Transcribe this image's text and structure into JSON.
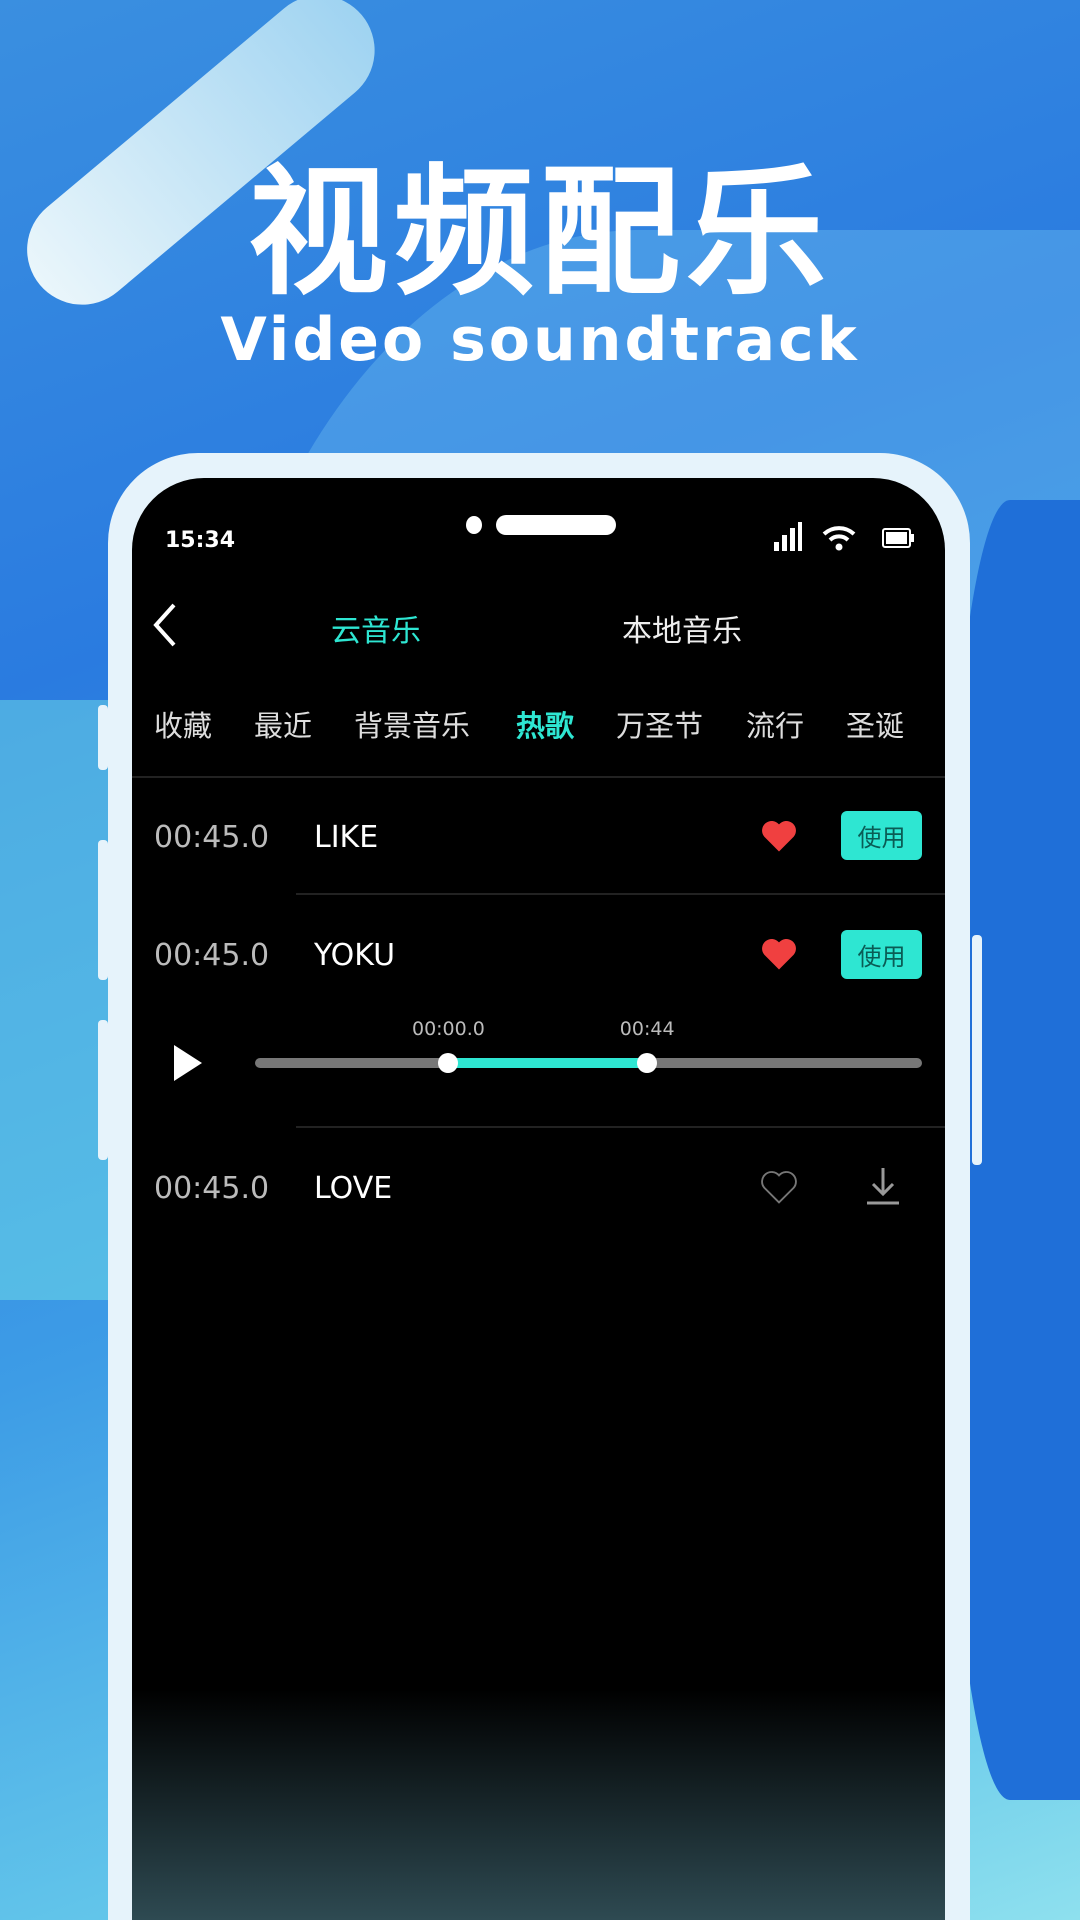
{
  "banner": {
    "title": "视频配乐",
    "subtitle": "Video soundtrack"
  },
  "status_bar": {
    "time": "15:34",
    "icons": [
      "signal-icon",
      "wifi-icon",
      "battery-icon"
    ]
  },
  "header": {
    "back_icon": "chevron-left-icon",
    "tabs": [
      {
        "label": "云音乐",
        "active": true
      },
      {
        "label": "本地音乐",
        "active": false
      }
    ]
  },
  "categories": [
    {
      "label": "收藏"
    },
    {
      "label": "最近"
    },
    {
      "label": "背景音乐"
    },
    {
      "label": "热歌",
      "active": true
    },
    {
      "label": "万圣节"
    },
    {
      "label": "流行"
    },
    {
      "label": "圣诞"
    }
  ],
  "tracks": [
    {
      "duration": "00:45.0",
      "name": "LIKE",
      "favorited": true,
      "action": "使用"
    },
    {
      "duration": "00:45.0",
      "name": "YOKU",
      "favorited": true,
      "action": "使用"
    },
    {
      "duration": "00:45.0",
      "name": "LOVE",
      "favorited": false,
      "action_icon": "download-icon"
    }
  ],
  "player": {
    "start_label": "00:00.0",
    "end_label": "00:44",
    "selection_start": 0.29,
    "selection_end": 0.588
  },
  "colors": {
    "accent": "#2ee6d2",
    "heart": "#f04040",
    "background": "#000000"
  }
}
